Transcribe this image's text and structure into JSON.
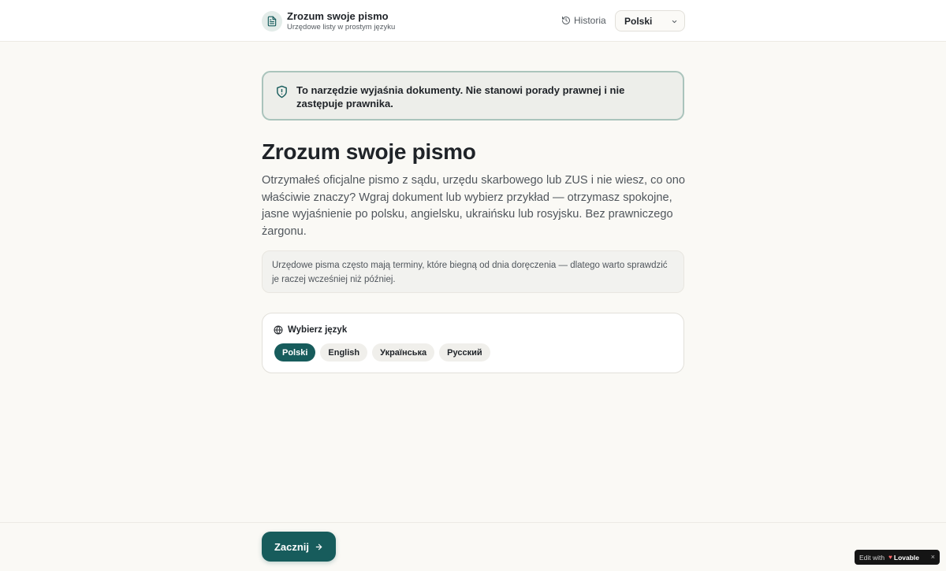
{
  "header": {
    "title": "Zrozum swoje pismo",
    "subtitle": "Urzędowe listy w prostym języku",
    "history_label": "Historia",
    "language_selected": "Polski"
  },
  "disclaimer": {
    "text": "To narzędzie wyjaśnia dokumenty. Nie stanowi porady prawnej i nie zastępuje prawnika."
  },
  "main": {
    "title": "Zrozum swoje pismo",
    "intro": "Otrzymałeś oficjalne pismo z sądu, urzędu skarbowego lub ZUS i nie wiesz, co ono właściwie znaczy? Wgraj dokument lub wybierz przykład — otrzymasz spokojne, jasne wyjaśnienie po polsku, angielsku, ukraińsku lub rosyjsku. Bez prawniczego żargonu.",
    "note": "Urzędowe pisma często mają terminy, które biegną od dnia doręczenia — dlatego warto sprawdzić je raczej wcześniej niż później."
  },
  "language_card": {
    "heading": "Wybierz język",
    "options": [
      {
        "label": "Polski",
        "active": true
      },
      {
        "label": "English",
        "active": false
      },
      {
        "label": "Українська",
        "active": false
      },
      {
        "label": "Русский",
        "active": false
      }
    ]
  },
  "footer": {
    "start_label": "Zacznij"
  },
  "badge": {
    "edit_text": "Edit with",
    "brand": "Lovable",
    "close": "×"
  },
  "colors": {
    "accent": "#175c5c",
    "disclaimer_border": "#aac4bc",
    "background": "#faf9f5"
  },
  "icons": {
    "brand": "document-icon",
    "history": "history-icon",
    "select": "chevron-down-icon",
    "disclaimer": "shield-alert-icon",
    "language": "globe-icon",
    "start": "arrow-right-icon"
  }
}
